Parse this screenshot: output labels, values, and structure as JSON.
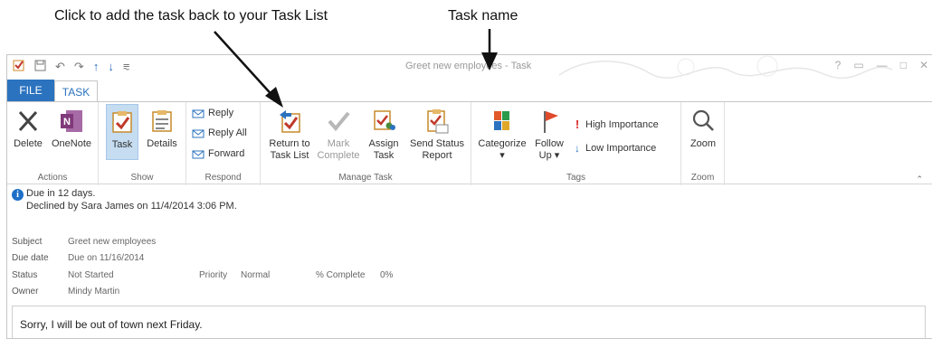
{
  "callouts": {
    "return_to_list": "Click to add the task back to your Task List",
    "task_name": "Task name"
  },
  "window": {
    "title": "Greet new employees - Task",
    "controls": [
      "?",
      "▭",
      "—",
      "□",
      "✕"
    ]
  },
  "qat": {
    "icons": [
      "task-icon",
      "save-icon",
      "undo-icon",
      "redo-icon",
      "up-arrow-icon",
      "down-arrow-icon",
      "customize-icon"
    ]
  },
  "tabs": {
    "file": "FILE",
    "task": "TASK"
  },
  "ribbon": {
    "actions": {
      "label": "Actions",
      "delete": "Delete",
      "onenote": "OneNote"
    },
    "show": {
      "label": "Show",
      "task": "Task",
      "details": "Details"
    },
    "respond": {
      "label": "Respond",
      "reply": "Reply",
      "reply_all": "Reply All",
      "forward": "Forward"
    },
    "manage": {
      "label": "Manage Task",
      "return_l1": "Return to",
      "return_l2": "Task List",
      "mark_l1": "Mark",
      "mark_l2": "Complete",
      "assign_l1": "Assign",
      "assign_l2": "Task",
      "status_l1": "Send Status",
      "status_l2": "Report"
    },
    "tags": {
      "label": "Tags",
      "categorize": "Categorize",
      "follow_l1": "Follow",
      "follow_l2": "Up",
      "high": "High Importance",
      "low": "Low Importance"
    },
    "zoom": {
      "label": "Zoom",
      "zoom": "Zoom"
    }
  },
  "info": {
    "due": "Due in 12 days.",
    "declined": "Declined by Sara James on 11/4/2014 3:06 PM."
  },
  "fields": {
    "subject_label": "Subject",
    "subject": "Greet new employees",
    "due_label": "Due date",
    "due": "Due on 11/16/2014",
    "status_label": "Status",
    "status": "Not Started",
    "priority_label": "Priority",
    "priority": "Normal",
    "complete_label": "% Complete",
    "complete": "0%",
    "owner_label": "Owner",
    "owner": "Mindy Martin"
  },
  "body": {
    "text": "Sorry, I will be out of town next Friday."
  },
  "colors": {
    "accent": "#2b73bf",
    "onenote": "#80397b",
    "flag": "#e04a2a",
    "selected": "#c5dcf1"
  }
}
